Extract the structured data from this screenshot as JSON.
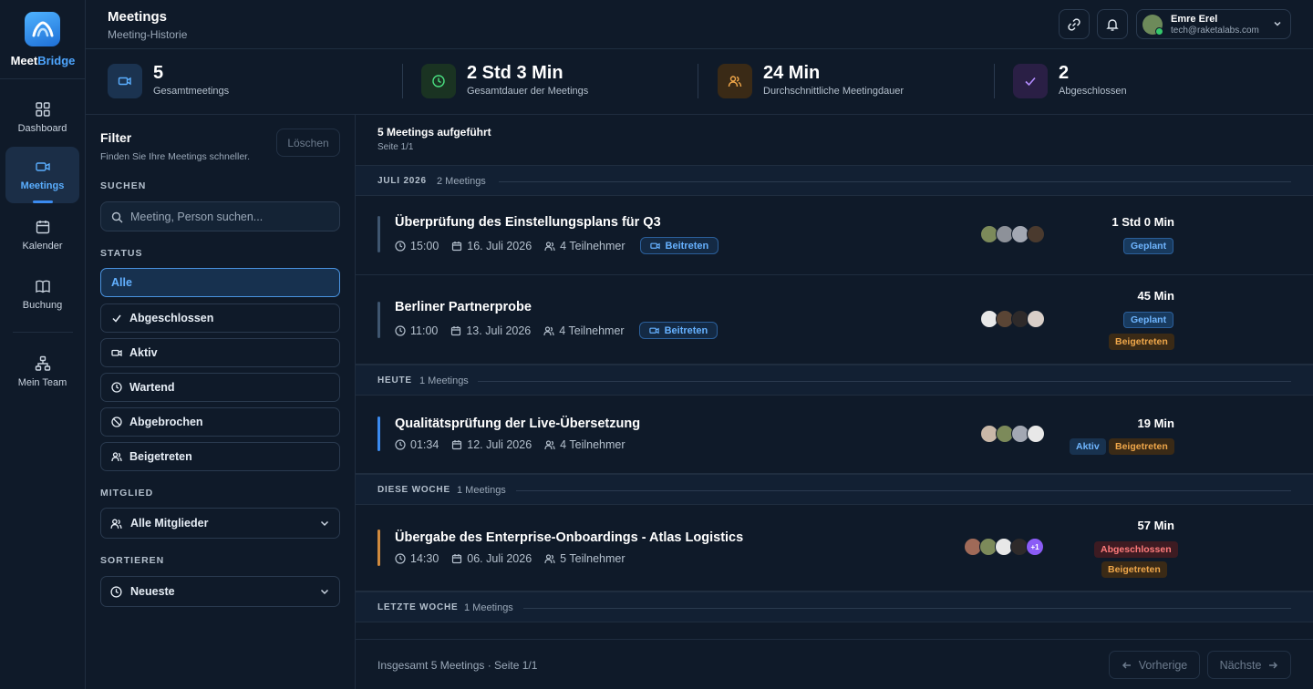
{
  "app": {
    "brand_a": "Meet",
    "brand_b": "Bridge"
  },
  "nav": [
    {
      "label": "Dashboard"
    },
    {
      "label": "Meetings"
    },
    {
      "label": "Kalender"
    },
    {
      "label": "Buchung"
    },
    {
      "label": "Mein Team"
    }
  ],
  "header": {
    "title": "Meetings",
    "subtitle": "Meeting-Historie"
  },
  "user": {
    "name": "Emre Erel",
    "email": "tech@raketalabs.com"
  },
  "stats": [
    {
      "value": "5",
      "label": "Gesamtmeetings"
    },
    {
      "value": "2 Std 3 Min",
      "label": "Gesamtdauer der Meetings"
    },
    {
      "value": "24 Min",
      "label": "Durchschnittliche Meetingdauer"
    },
    {
      "value": "2",
      "label": "Abgeschlossen"
    }
  ],
  "filter": {
    "title": "Filter",
    "subtitle": "Finden Sie Ihre Meetings schneller.",
    "clear": "Löschen",
    "search_label": "SUCHEN",
    "search_placeholder": "Meeting, Person suchen...",
    "status_label": "STATUS",
    "statuses": [
      "Alle",
      "Abgeschlossen",
      "Aktiv",
      "Wartend",
      "Abgebrochen",
      "Beigetreten"
    ],
    "member_label": "MITGLIED",
    "member_value": "Alle Mitglieder",
    "sort_label": "SORTIEREN",
    "sort_value": "Neueste"
  },
  "list": {
    "count_text": "5 Meetings aufgeführt",
    "page_text": "Seite 1/1",
    "groups": [
      {
        "name": "JULI 2026",
        "count": "2 Meetings"
      },
      {
        "name": "HEUTE",
        "count": "1 Meetings"
      },
      {
        "name": "DIESE WOCHE",
        "count": "1 Meetings"
      },
      {
        "name": "LETZTE WOCHE",
        "count": "1 Meetings"
      }
    ],
    "meetings": [
      {
        "title": "Überprüfung des Einstellungsplans für Q3",
        "time": "15:00",
        "date": "16. Juli 2026",
        "participants": "4 Teilnehmer",
        "join": "Beitreten",
        "duration": "1 Std 0 Min",
        "badges": [
          "Geplant"
        ]
      },
      {
        "title": "Berliner Partnerprobe",
        "time": "11:00",
        "date": "13. Juli 2026",
        "participants": "4 Teilnehmer",
        "join": "Beitreten",
        "duration": "45 Min",
        "badges": [
          "Geplant",
          "Beigetreten"
        ]
      },
      {
        "title": "Qualitätsprüfung der Live-Übersetzung",
        "time": "01:34",
        "date": "12. Juli 2026",
        "participants": "4 Teilnehmer",
        "duration": "19 Min",
        "badges": [
          "Aktiv",
          "Beigetreten"
        ]
      },
      {
        "title": "Übergabe des Enterprise-Onboardings - Atlas Logistics",
        "time": "14:30",
        "date": "06. Juli 2026",
        "participants": "5 Teilnehmer",
        "duration": "57 Min",
        "badges": [
          "Abgeschlossen",
          "Beigetreten"
        ],
        "more_avatars": "+1"
      }
    ],
    "footer_text": "Insgesamt 5 Meetings · Seite 1/1",
    "prev": "Vorherige",
    "next": "Nächste"
  },
  "colors": {
    "accent": "#3b8bf0",
    "bg": "#0f1a29",
    "scheduled": "#6fb6ff",
    "joined": "#f0a74a",
    "done": "#ff7b7b"
  }
}
